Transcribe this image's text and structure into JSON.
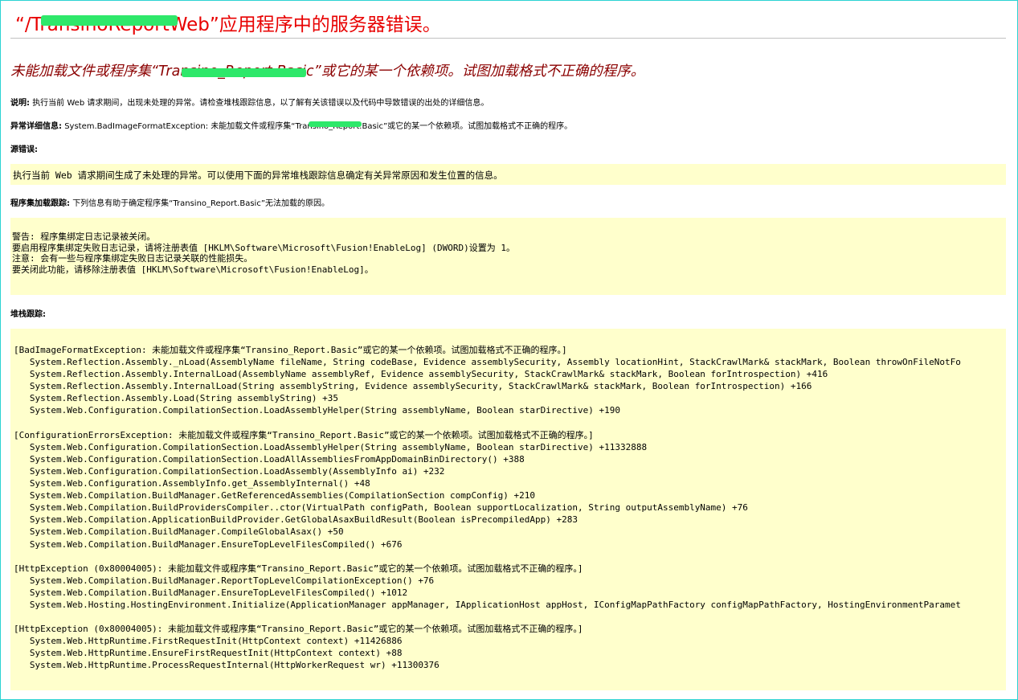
{
  "page": {
    "title": "“/TransinoReportWeb”应用程序中的服务器错误。",
    "subtitle": "未能加载文件或程序集“Transino_Report.Basic”或它的某一个依赖项。试图加载格式不正确的程序。",
    "description_label": "说明:",
    "description_text": "执行当前 Web 请求期间，出现未处理的异常。请检查堆栈跟踪信息，以了解有关该错误以及代码中导致错误的出处的详细信息。",
    "exception_label": "异常详细信息:",
    "exception_text": "System.BadImageFormatException: 未能加载文件或程序集“Transino_Report.Basic”或它的某一个依赖项。试图加载格式不正确的程序。",
    "source_error_label": "源错误:",
    "source_error_text": "执行当前 Web 请求期间生成了未处理的异常。可以使用下面的异常堆栈跟踪信息确定有关异常原因和发生位置的信息。",
    "assembly_trace_label": "程序集加载跟踪:",
    "assembly_trace_text": "下列信息有助于确定程序集“Transino_Report.Basic”无法加载的原因。",
    "fusion_log": "警告: 程序集绑定日志记录被关闭。\n要启用程序集绑定失败日志记录，请将注册表值 [HKLM\\Software\\Microsoft\\Fusion!EnableLog] (DWORD)设置为 1。\n注意: 会有一些与程序集绑定失败日志记录关联的性能损失。\n要关闭此功能，请移除注册表值 [HKLM\\Software\\Microsoft\\Fusion!EnableLog]。",
    "stack_trace_label": "堆栈跟踪:",
    "stack_trace": "[BadImageFormatException: 未能加载文件或程序集“Transino_Report.Basic”或它的某一个依赖项。试图加载格式不正确的程序。]\n   System.Reflection.Assembly._nLoad(AssemblyName fileName, String codeBase, Evidence assemblySecurity, Assembly locationHint, StackCrawlMark& stackMark, Boolean throwOnFileNotFo\n   System.Reflection.Assembly.InternalLoad(AssemblyName assemblyRef, Evidence assemblySecurity, StackCrawlMark& stackMark, Boolean forIntrospection) +416\n   System.Reflection.Assembly.InternalLoad(String assemblyString, Evidence assemblySecurity, StackCrawlMark& stackMark, Boolean forIntrospection) +166\n   System.Reflection.Assembly.Load(String assemblyString) +35\n   System.Web.Configuration.CompilationSection.LoadAssemblyHelper(String assemblyName, Boolean starDirective) +190\n\n[ConfigurationErrorsException: 未能加载文件或程序集“Transino_Report.Basic”或它的某一个依赖项。试图加载格式不正确的程序。]\n   System.Web.Configuration.CompilationSection.LoadAssemblyHelper(String assemblyName, Boolean starDirective) +11332888\n   System.Web.Configuration.CompilationSection.LoadAllAssembliesFromAppDomainBinDirectory() +388\n   System.Web.Configuration.CompilationSection.LoadAssembly(AssemblyInfo ai) +232\n   System.Web.Configuration.AssemblyInfo.get_AssemblyInternal() +48\n   System.Web.Compilation.BuildManager.GetReferencedAssemblies(CompilationSection compConfig) +210\n   System.Web.Compilation.BuildProvidersCompiler..ctor(VirtualPath configPath, Boolean supportLocalization, String outputAssemblyName) +76\n   System.Web.Compilation.ApplicationBuildProvider.GetGlobalAsaxBuildResult(Boolean isPrecompiledApp) +283\n   System.Web.Compilation.BuildManager.CompileGlobalAsax() +50\n   System.Web.Compilation.BuildManager.EnsureTopLevelFilesCompiled() +676\n\n[HttpException (0x80004005): 未能加载文件或程序集“Transino_Report.Basic”或它的某一个依赖项。试图加载格式不正确的程序。]\n   System.Web.Compilation.BuildManager.ReportTopLevelCompilationException() +76\n   System.Web.Compilation.BuildManager.EnsureTopLevelFilesCompiled() +1012\n   System.Web.Hosting.HostingEnvironment.Initialize(ApplicationManager appManager, IApplicationHost appHost, IConfigMapPathFactory configMapPathFactory, HostingEnvironmentParamet\n\n[HttpException (0x80004005): 未能加载文件或程序集“Transino_Report.Basic”或它的某一个依赖项。试图加载格式不正确的程序。]\n   System.Web.HttpRuntime.FirstRequestInit(HttpContext context) +11426886\n   System.Web.HttpRuntime.EnsureFirstRequestInit(HttpContext context) +88\n   System.Web.HttpRuntime.ProcessRequestInternal(HttpWorkerRequest wr) +11300376"
  },
  "colors": {
    "title": "#e80000",
    "subtitle": "#8b0000",
    "box_background": "#ffffcc",
    "redaction": "#2ee86a",
    "frame_border": "#2bd3d3"
  }
}
